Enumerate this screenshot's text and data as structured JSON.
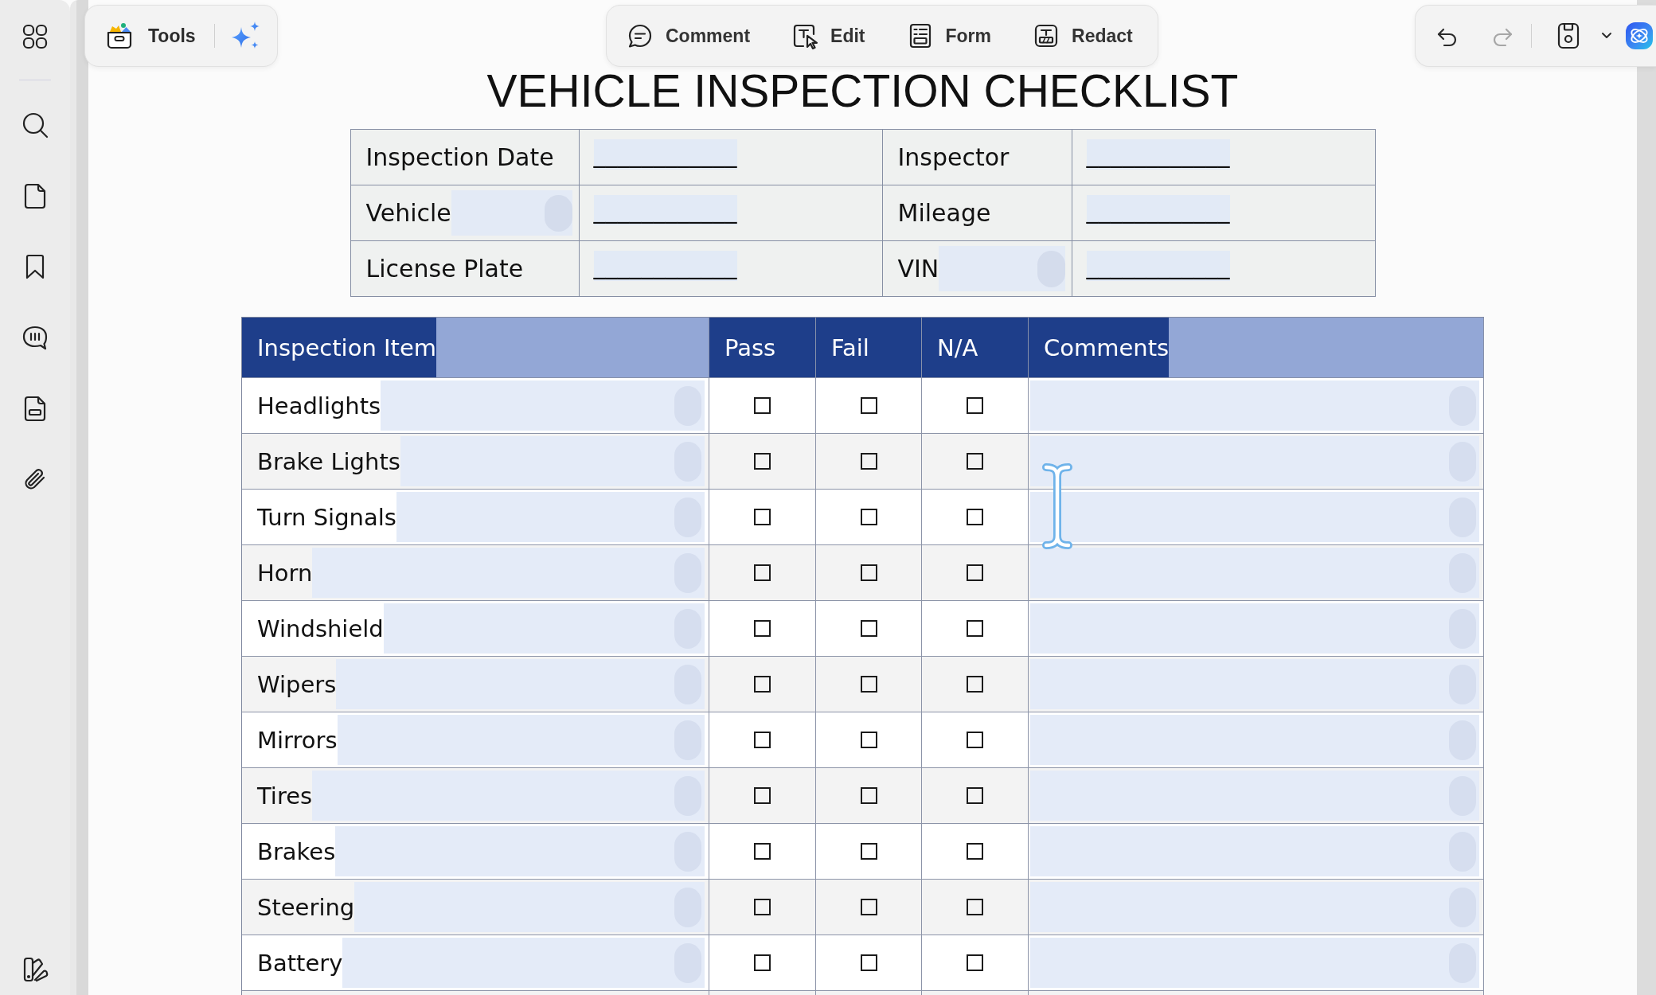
{
  "toolbar": {
    "tools_button": {
      "label": "Tools"
    },
    "modes": [
      {
        "kind": "comment",
        "label": "Comment"
      },
      {
        "kind": "edit",
        "label": "Edit"
      },
      {
        "kind": "form",
        "label": "Form"
      },
      {
        "kind": "redact",
        "label": "Redact"
      }
    ],
    "history": {
      "undo": {
        "disabled": false
      },
      "redo": {
        "disabled": true
      }
    }
  },
  "document": {
    "title": "VEHICLE INSPECTION CHECKLIST",
    "info_table": {
      "rows": [
        {
          "cells": [
            {
              "label": "Inspection Date",
              "label_field": false,
              "blank": "____________"
            },
            {
              "label": "Inspector",
              "label_field": false,
              "blank": "____________"
            }
          ]
        },
        {
          "cells": [
            {
              "label": "Vehicle",
              "label_field": true,
              "blank": "____________"
            },
            {
              "label": "Mileage",
              "label_field": false,
              "blank": "____________"
            }
          ]
        },
        {
          "cells": [
            {
              "label": "License Plate",
              "label_field": false,
              "blank": "____________"
            },
            {
              "label": "VIN",
              "label_field": true,
              "blank": "____________"
            }
          ]
        }
      ]
    },
    "checklist": {
      "columns": [
        {
          "kind": "item",
          "label": "Inspection Item",
          "field": true
        },
        {
          "kind": "check",
          "label": "Pass",
          "field": false
        },
        {
          "kind": "check",
          "label": "Fail",
          "field": false
        },
        {
          "kind": "check",
          "label": "N/A",
          "field": false
        },
        {
          "kind": "comment",
          "label": "Comments",
          "field": true
        }
      ],
      "rows": [
        {
          "item": "Headlights",
          "checks": [
            {
              "checked": false
            },
            {
              "checked": false
            },
            {
              "checked": false
            }
          ]
        },
        {
          "item": "Brake Lights",
          "checks": [
            {
              "checked": false
            },
            {
              "checked": false
            },
            {
              "checked": false
            }
          ]
        },
        {
          "item": "Turn Signals",
          "checks": [
            {
              "checked": false
            },
            {
              "checked": false
            },
            {
              "checked": false
            }
          ]
        },
        {
          "item": "Horn",
          "checks": [
            {
              "checked": false
            },
            {
              "checked": false
            },
            {
              "checked": false
            }
          ]
        },
        {
          "item": "Windshield",
          "checks": [
            {
              "checked": false
            },
            {
              "checked": false
            },
            {
              "checked": false
            }
          ]
        },
        {
          "item": "Wipers",
          "checks": [
            {
              "checked": false
            },
            {
              "checked": false
            },
            {
              "checked": false
            }
          ]
        },
        {
          "item": "Mirrors",
          "checks": [
            {
              "checked": false
            },
            {
              "checked": false
            },
            {
              "checked": false
            }
          ]
        },
        {
          "item": "Tires",
          "checks": [
            {
              "checked": false
            },
            {
              "checked": false
            },
            {
              "checked": false
            }
          ]
        },
        {
          "item": "Brakes",
          "checks": [
            {
              "checked": false
            },
            {
              "checked": false
            },
            {
              "checked": false
            }
          ]
        },
        {
          "item": "Steering",
          "checks": [
            {
              "checked": false
            },
            {
              "checked": false
            },
            {
              "checked": false
            }
          ]
        },
        {
          "item": "Battery",
          "checks": [
            {
              "checked": false
            },
            {
              "checked": false
            },
            {
              "checked": false
            }
          ]
        }
      ]
    }
  }
}
